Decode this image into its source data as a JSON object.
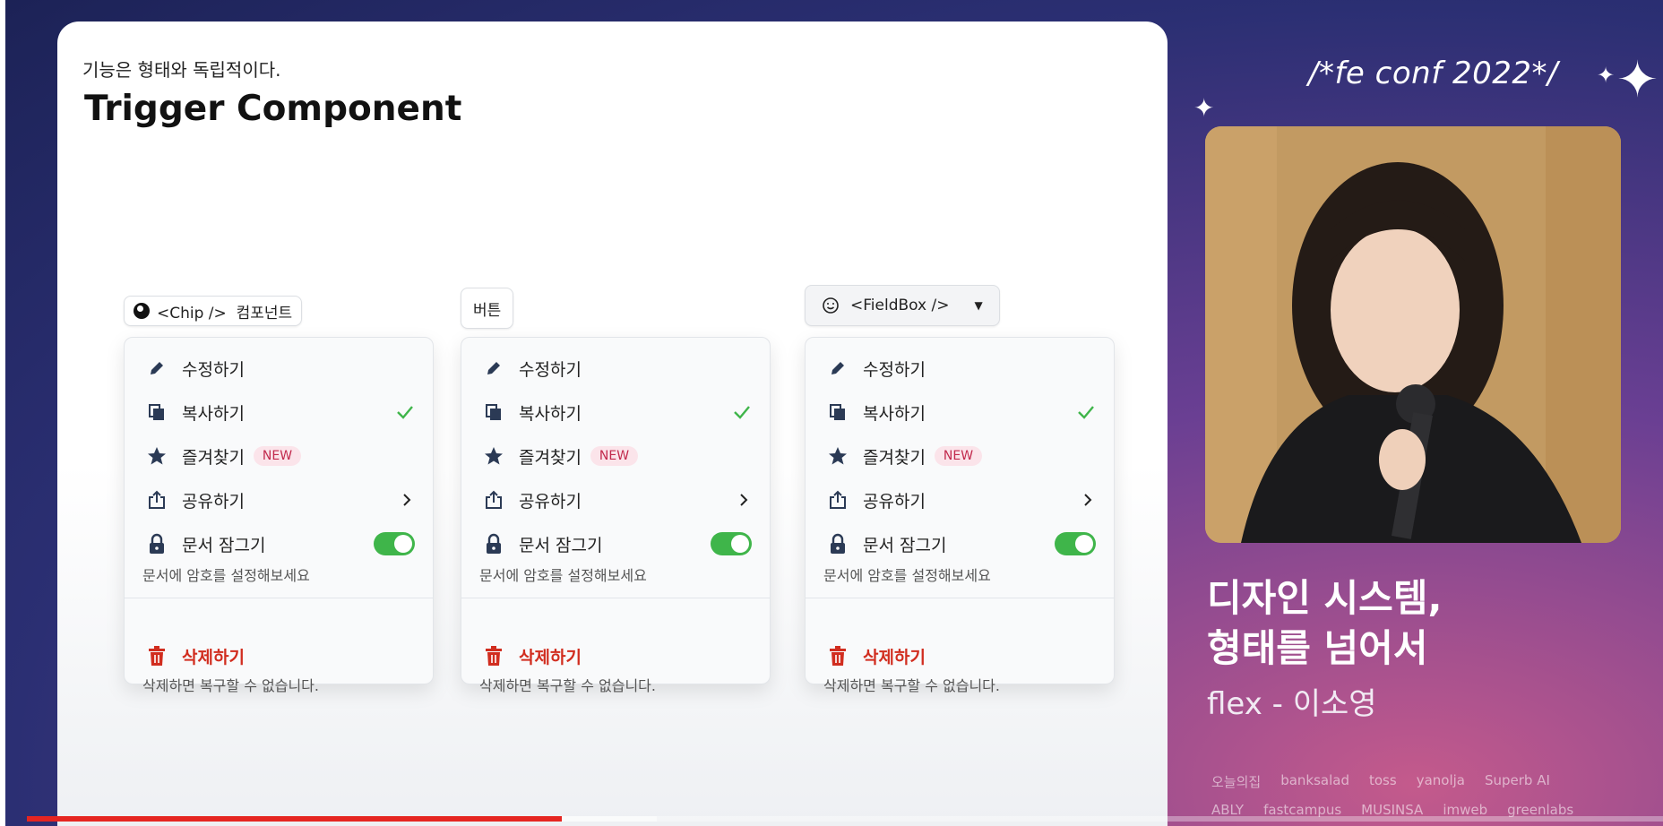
{
  "slide": {
    "kicker": "기능은 형태와 독립적이다.",
    "title": "Trigger Component"
  },
  "triggers": {
    "chip": {
      "icon": "eight-ball-icon",
      "label": "<Chip />  컴포넌트"
    },
    "button": {
      "label": "버튼"
    },
    "fieldbox": {
      "icon": "smiley-icon",
      "label": "<FieldBox />"
    }
  },
  "menu": {
    "edit": "수정하기",
    "copy": "복사하기",
    "favorite": "즐겨찾기",
    "new_badge": "NEW",
    "share": "공유하기",
    "lock": "문서 잠그기",
    "lock_desc": "문서에 암호를 설정해보세요",
    "delete": "삭제하기",
    "delete_desc": "삭제하면 복구할 수 없습니다.",
    "lock_toggle_on": true,
    "colors": {
      "check": "#3fb54a",
      "danger": "#d12d1f",
      "toggle": "#3fb54a",
      "badge_text": "#c22a4d"
    }
  },
  "conference": {
    "logo": "/*fe conf 2022*/",
    "talk_title_line1": "디자인 시스템,",
    "talk_title_line2": "형태를 넘어서",
    "speaker": "flex - 이소영"
  },
  "sponsors": {
    "row1": [
      "오늘의집",
      "banksalad",
      "toss",
      "yanolja",
      "Superb AI"
    ],
    "row2": [
      "ABLY",
      "fastcampus",
      "MUSINSA",
      "imweb",
      "greenlabs"
    ]
  },
  "player": {
    "progress": 0.327,
    "buffered": 0.385,
    "progress_color": "#e52521"
  }
}
